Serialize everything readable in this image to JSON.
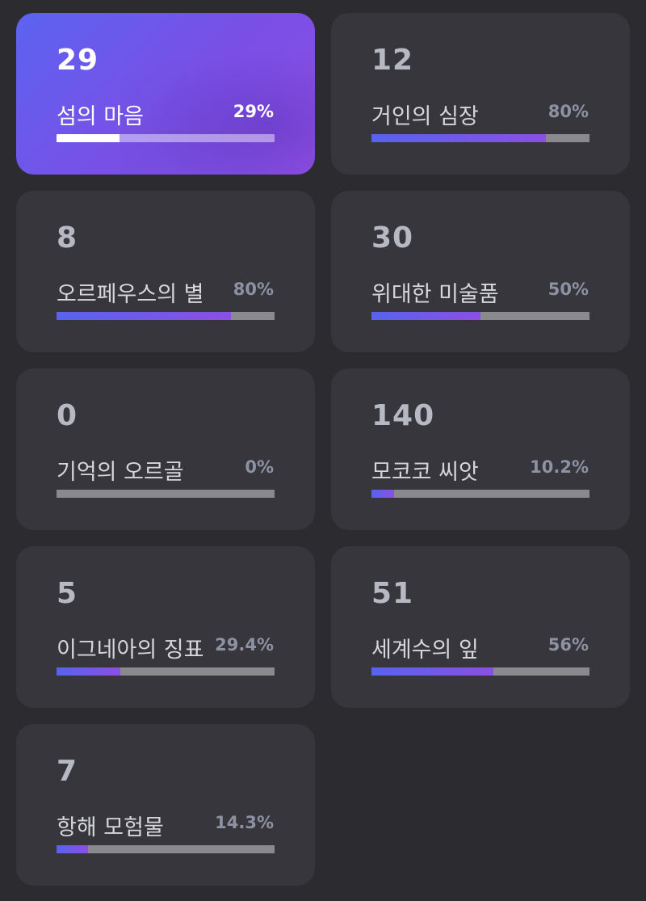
{
  "cards": [
    {
      "count": "29",
      "name": "섬의 마음",
      "percent": "29%",
      "progress": 0.29,
      "active": true
    },
    {
      "count": "12",
      "name": "거인의 심장",
      "percent": "80%",
      "progress": 0.8,
      "active": false
    },
    {
      "count": "8",
      "name": "오르페우스의 별",
      "percent": "80%",
      "progress": 0.8,
      "active": false
    },
    {
      "count": "30",
      "name": "위대한 미술품",
      "percent": "50%",
      "progress": 0.5,
      "active": false
    },
    {
      "count": "0",
      "name": "기억의 오르골",
      "percent": "0%",
      "progress": 0.0,
      "active": false
    },
    {
      "count": "140",
      "name": "모코코 씨앗",
      "percent": "10.2%",
      "progress": 0.102,
      "active": false
    },
    {
      "count": "5",
      "name": "이그네아의 징표",
      "percent": "29.4%",
      "progress": 0.294,
      "active": false
    },
    {
      "count": "51",
      "name": "세계수의 잎",
      "percent": "56%",
      "progress": 0.56,
      "active": false
    },
    {
      "count": "7",
      "name": "항해 모험물",
      "percent": "14.3%",
      "progress": 0.143,
      "active": false
    }
  ],
  "colors": {
    "background": "#2b2b30",
    "card": "#36363c",
    "track": "#8a8a8e",
    "accent_start": "#5763ee",
    "accent_end": "#8b4fe3"
  }
}
